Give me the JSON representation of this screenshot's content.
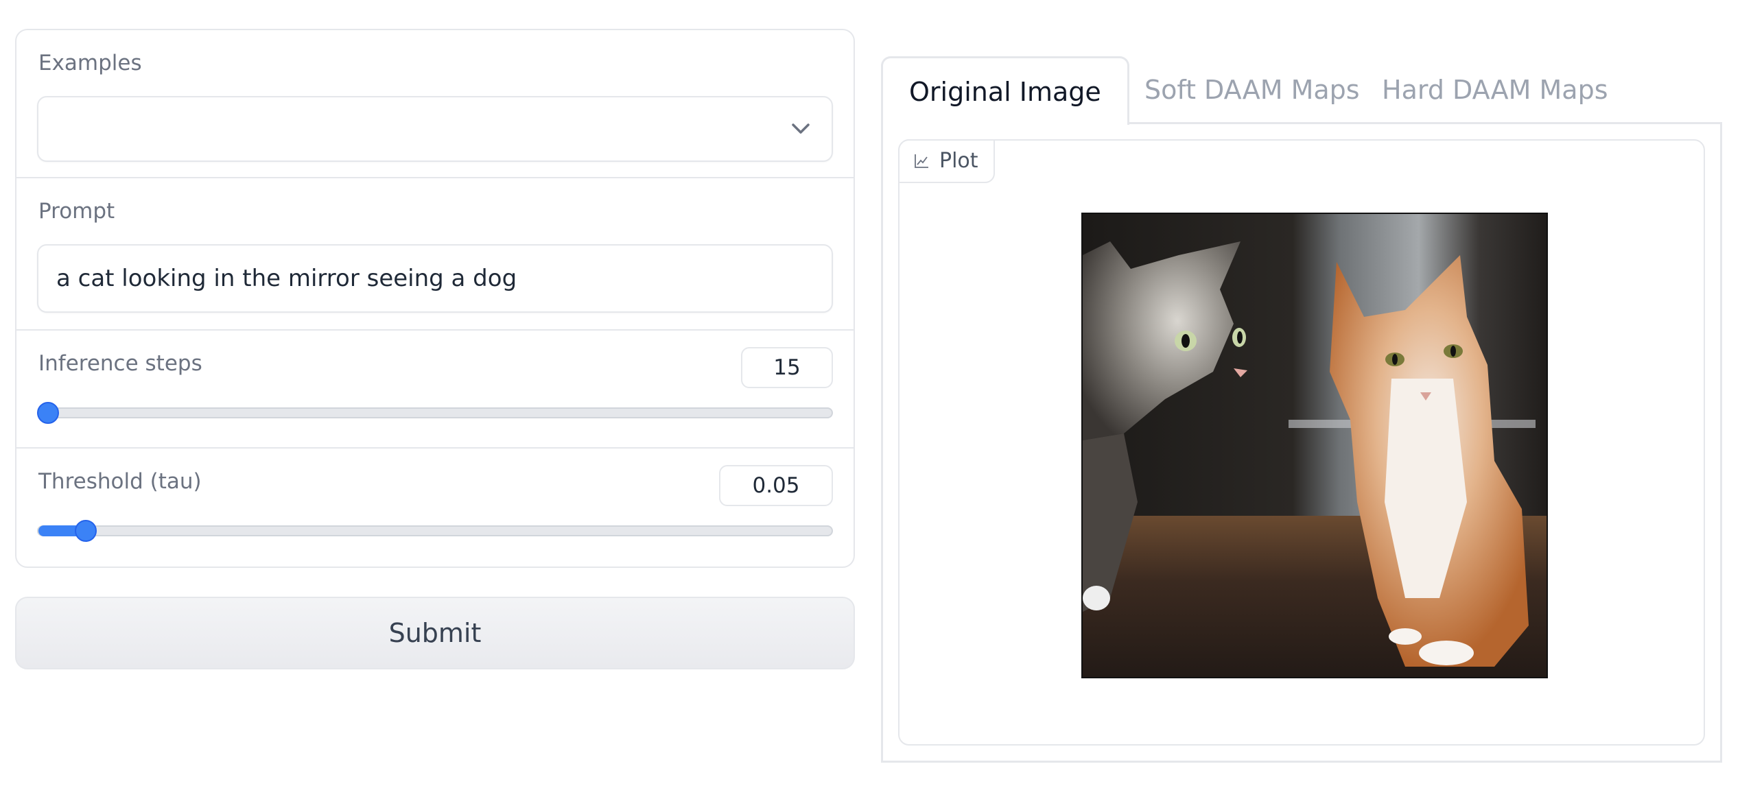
{
  "form": {
    "examples": {
      "label": "Examples",
      "value": "",
      "icon": "chevron-down-icon"
    },
    "prompt": {
      "label": "Prompt",
      "value": "a cat looking in the mirror seeing a dog"
    },
    "inference_steps": {
      "label": "Inference steps",
      "value": "15",
      "slider_fraction": 0.0
    },
    "threshold": {
      "label": "Threshold (tau)",
      "value": "0.05",
      "slider_fraction": 0.06
    },
    "submit_label": "Submit"
  },
  "output": {
    "tabs": [
      {
        "label": "Original Image",
        "active": true
      },
      {
        "label": "Soft DAAM Maps",
        "active": false
      },
      {
        "label": "Hard DAAM Maps",
        "active": false
      }
    ],
    "plot_label": "Plot",
    "plot_icon": "chart-icon"
  },
  "colors": {
    "accent": "#3b82f6",
    "border": "#e5e7eb",
    "muted_text": "#6b7280"
  }
}
